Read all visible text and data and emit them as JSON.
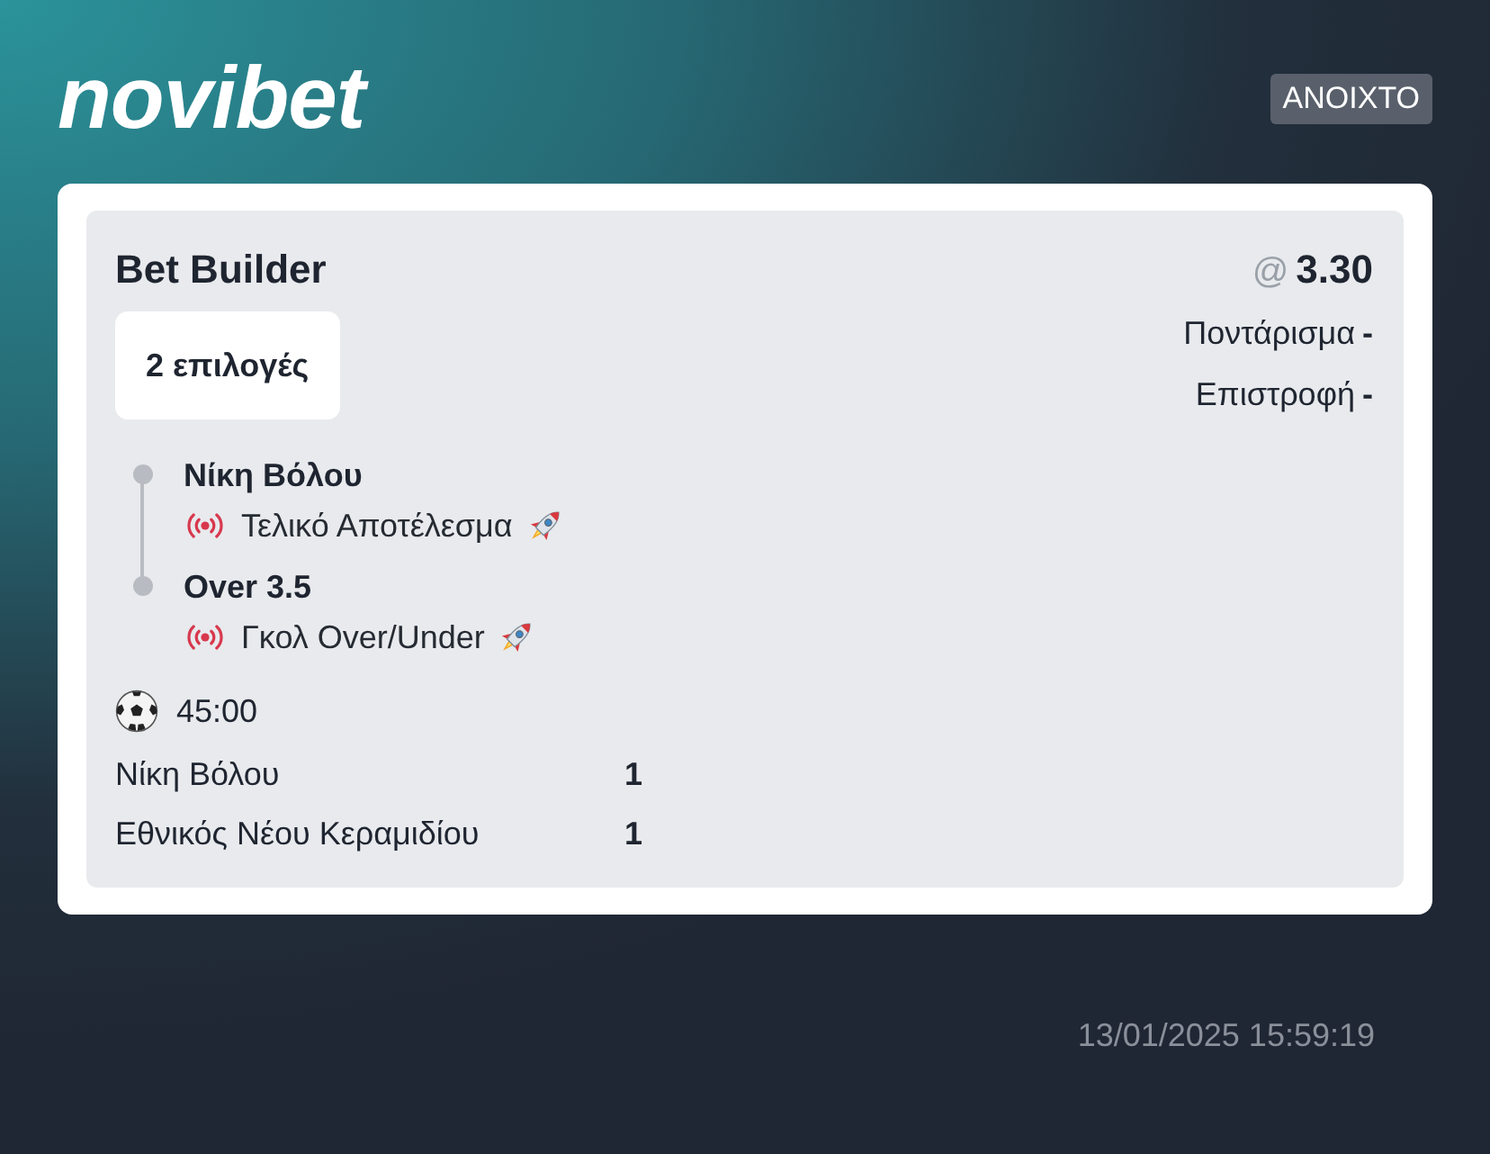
{
  "header": {
    "logo": "novibet",
    "status_badge": "ΑΝΟΙΧΤΟ"
  },
  "bet": {
    "title": "Bet Builder",
    "selections_count": "2 επιλογές",
    "odds_prefix": "@",
    "odds": "3.30",
    "stake_label": "Ποντάρισμα",
    "stake_value": "-",
    "return_label": "Επιστροφή",
    "return_value": "-",
    "selections": [
      {
        "name": "Νίκη Βόλου",
        "market": "Τελικό Αποτέλεσμα",
        "live": true,
        "boosted": true
      },
      {
        "name": "Over 3.5",
        "market": "Γκολ Over/Under",
        "live": true,
        "boosted": true
      }
    ],
    "match": {
      "clock": "45:00",
      "teams": [
        {
          "name": "Νίκη Βόλου",
          "score": "1"
        },
        {
          "name": "Εθνικός Νέου Κεραμιδίου",
          "score": "1"
        }
      ]
    }
  },
  "timestamp": "13/01/2025 15:59:19"
}
